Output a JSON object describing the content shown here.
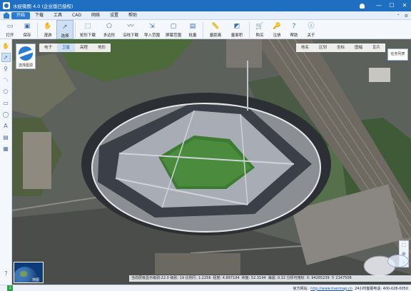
{
  "app": {
    "title": "水经微图 4.0 (企业版已授权)"
  },
  "menu": {
    "items": [
      {
        "label": "开始",
        "active": true
      },
      {
        "label": "下载",
        "active": false
      },
      {
        "label": "工具",
        "active": false
      },
      {
        "label": "CAD",
        "active": false
      },
      {
        "label": "网络",
        "active": false
      },
      {
        "label": "设置",
        "active": false
      },
      {
        "label": "帮助",
        "active": false
      }
    ]
  },
  "ribbon": {
    "items": [
      {
        "label": "打开",
        "icon": "folder-icon"
      },
      {
        "label": "保存",
        "icon": "save-icon"
      },
      {
        "label": "漫游",
        "icon": "hand-icon"
      },
      {
        "label": "选择",
        "icon": "cursor-icon",
        "active": true
      },
      {
        "label": "矩形下载",
        "icon": "rectangle-download-icon"
      },
      {
        "label": "多边形",
        "icon": "polygon-icon"
      },
      {
        "label": "沿线下载",
        "icon": "line-download-icon"
      },
      {
        "label": "导入范围",
        "icon": "import-range-icon"
      },
      {
        "label": "屏幕范围",
        "icon": "screen-range-icon"
      },
      {
        "label": "批量",
        "icon": "batch-icon"
      },
      {
        "label": "量距离",
        "icon": "measure-distance-icon"
      },
      {
        "label": "量面积",
        "icon": "measure-area-icon"
      },
      {
        "label": "购买",
        "icon": "cart-icon"
      },
      {
        "label": "注册",
        "icon": "register-icon"
      },
      {
        "label": "帮助",
        "icon": "help-icon"
      },
      {
        "label": "关于",
        "icon": "about-icon"
      }
    ]
  },
  "map": {
    "source_label": "选择图源",
    "types": [
      {
        "label": "电子",
        "active": false
      },
      {
        "label": "卫星",
        "active": true
      },
      {
        "label": "高程",
        "active": false
      },
      {
        "label": "地形",
        "active": false
      }
    ],
    "layers": [
      "地名",
      "区划",
      "坐标",
      "图幅",
      "瓦片"
    ],
    "task_list": "任务列表",
    "overview_label": "地图",
    "status": {
      "level": "当前层级显示级别:22.0 级别: 19 比例尺: 1:2256",
      "lng": "经度: 4.897194",
      "lat": "纬度: 52.3144",
      "alt": "海拔: 0.32 分析可用标",
      "x": "X: 94265239",
      "y": "Y: 2147508"
    }
  },
  "bottom": {
    "site_label": "官方网站:",
    "site_link": "http://www.rivermap.cn",
    "hotline": "24小时客服电话: 400-028-0050"
  }
}
